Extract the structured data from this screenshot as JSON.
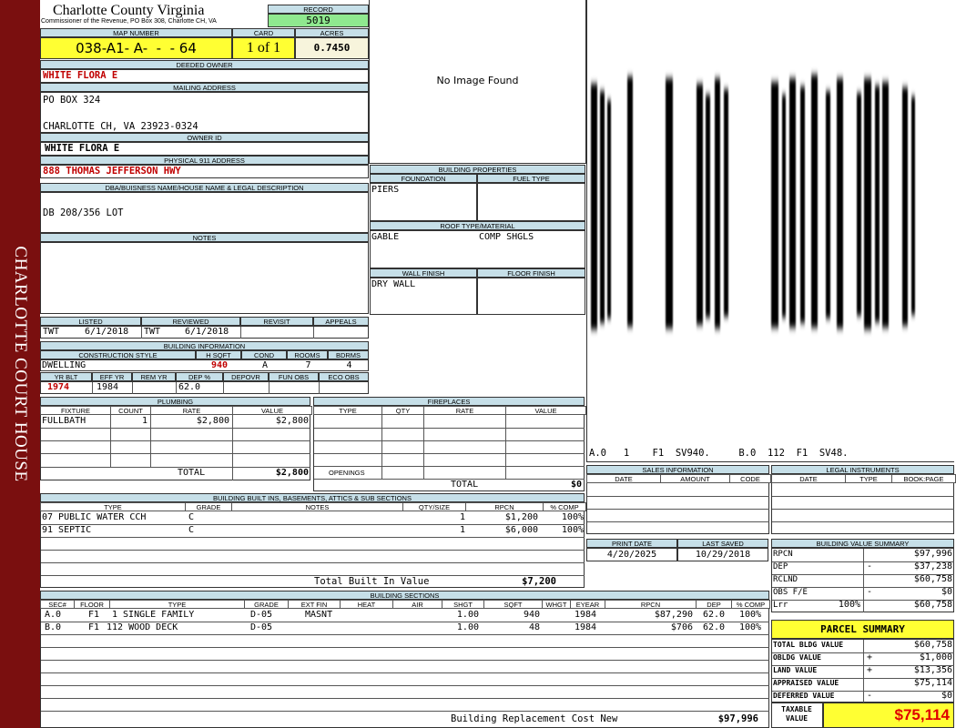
{
  "sidebar": {
    "text": "CHARLOTTE COURT HOUSE",
    "color": "#7a0f0f"
  },
  "header": {
    "county": "Charlotte County Virginia",
    "subtitle": "Commissioner of the Revenue, PO Box 308, Charlotte CH, VA",
    "record_label": "RECORD",
    "record": "5019",
    "map_number_label": "MAP NUMBER",
    "map_number": "038-A1- A-  -  - 64",
    "card_label": "CARD",
    "card": "1 of 1",
    "acres_label": "ACRES",
    "acres": "0.7450"
  },
  "owner": {
    "deeded_label": "DEEDED OWNER",
    "deeded": "WHITE FLORA E",
    "mailing_label": "MAILING ADDRESS",
    "mailing_line1": "PO BOX 324",
    "mailing_line2": "CHARLOTTE CH, VA 23923-0324",
    "owner_id_label": "OWNER ID",
    "owner_id": "WHITE FLORA E",
    "physical_label": "PHYSICAL 911 ADDRESS",
    "physical": "888 THOMAS JEFFERSON HWY",
    "dba_label": "DBA/BUISNESS NAME/HOUSE NAME & LEGAL DESCRIPTION",
    "dba": "DB 208/356 LOT",
    "notes_label": "NOTES"
  },
  "image": {
    "text": "No Image Found"
  },
  "building_properties": {
    "title": "BUILDING PROPERTIES",
    "foundation_label": "FOUNDATION",
    "foundation": "PIERS",
    "fuel_label": "FUEL TYPE",
    "roof_label": "ROOF TYPE/MATERIAL",
    "roof_type": "GABLE",
    "roof_material": "COMP SHGLS",
    "wall_label": "WALL FINISH",
    "wall": "DRY WALL",
    "floor_label": "FLOOR FINISH"
  },
  "sketch": {
    "caption": "A.0   1    F1  SV940.     B.0  112  F1  SV48."
  },
  "review": {
    "listed_label": "LISTED",
    "listed_by": "TWT",
    "listed_date": "6/1/2018",
    "reviewed_label": "REVIEWED",
    "reviewed_by": "TWT",
    "reviewed_date": "6/1/2018",
    "revisit_label": "REVISIT",
    "appeals_label": "APPEALS"
  },
  "building_info": {
    "title": "BUILDING INFORMATION",
    "style_label": "CONSTRUCTION STYLE",
    "style": "DWELLING",
    "hsqft_label": "H SQFT",
    "hsqft": "940",
    "cond_label": "COND",
    "cond": "A",
    "rooms_label": "ROOMS",
    "rooms": "7",
    "bdrms_label": "BDRMS",
    "bdrms": "4",
    "yrblt_label": "YR BLT",
    "yrblt": "1974",
    "effyr_label": "EFF YR",
    "effyr": "1984",
    "remyr_label": "REM YR",
    "dep_label": "DEP %",
    "dep": "62.0",
    "depovr_label": "DEPOVR",
    "funobs_label": "FUN OBS",
    "ecoobs_label": "ECO OBS"
  },
  "plumbing": {
    "title": "PLUMBING",
    "headers": [
      "FIXTURE",
      "COUNT",
      "RATE",
      "VALUE"
    ],
    "rows": [
      {
        "fixture": "FULLBATH",
        "count": "1",
        "rate": "$2,800",
        "value": "$2,800"
      }
    ],
    "total_label": "TOTAL",
    "total": "$2,800"
  },
  "fireplaces": {
    "title": "FIREPLACES",
    "headers": [
      "TYPE",
      "QTY",
      "RATE",
      "VALUE"
    ],
    "openings_label": "OPENINGS",
    "total_label": "TOTAL",
    "total": "$0"
  },
  "built_ins": {
    "title": "BUILDING BUILT INS, BASEMENTS, ATTICS & SUB SECTIONS",
    "headers": [
      "TYPE",
      "GRADE",
      "NOTES",
      "QTY/SIZE",
      "RPCN",
      "% COMP"
    ],
    "rows": [
      {
        "type": "07 PUBLIC WATER CCH",
        "grade": "C",
        "notes": "",
        "qty": "1",
        "rpcn": "$1,200",
        "comp": "100%"
      },
      {
        "type": "91 SEPTIC",
        "grade": "C",
        "notes": "",
        "qty": "1",
        "rpcn": "$6,000",
        "comp": "100%"
      }
    ],
    "total_label": "Total Built In Value",
    "total": "$7,200"
  },
  "sales": {
    "title": "SALES INFORMATION",
    "headers": [
      "DATE",
      "AMOUNT",
      "CODE"
    ]
  },
  "legal": {
    "title": "LEGAL INSTRUMENTS",
    "headers": [
      "DATE",
      "TYPE",
      "BOOK:PAGE"
    ]
  },
  "dates": {
    "print_label": "PRINT DATE",
    "print": "4/20/2025",
    "saved_label": "LAST SAVED",
    "saved": "10/29/2018"
  },
  "value_summary": {
    "title": "BUILDING VALUE SUMMARY",
    "rows": [
      {
        "label": "RPCN",
        "sign": "",
        "value": "$97,996"
      },
      {
        "label": "DEP",
        "sign": "-",
        "value": "$37,238"
      },
      {
        "label": "RCLND",
        "sign": "",
        "value": "$60,758"
      },
      {
        "label": "OBS F/E",
        "sign": "-",
        "value": "$0"
      },
      {
        "label": "Lrr",
        "sign": "100%",
        "value": "$60,758"
      }
    ]
  },
  "sections": {
    "title": "BUILDING SECTIONS",
    "headers": [
      "SEC#",
      "FLOOR",
      "TYPE",
      "GRADE",
      "EXT FIN",
      "HEAT",
      "AIR",
      "SHGT",
      "SQFT",
      "WHGT",
      "EYEAR",
      "RPCN",
      "DEP",
      "% COMP"
    ],
    "rows": [
      {
        "sec": "A.0",
        "floor": "F1",
        "type": "1 SINGLE FAMILY",
        "grade": "D-05",
        "ext": "MASNT",
        "heat": "",
        "air": "",
        "shgt": "1.00",
        "sqft": "940",
        "whgt": "",
        "eyear": "1984",
        "rpcn": "$87,290",
        "dep": "62.0",
        "comp": "100%"
      },
      {
        "sec": "B.0",
        "floor": "F1",
        "type": "112 WOOD DECK",
        "grade": "D-05",
        "ext": "",
        "heat": "",
        "air": "",
        "shgt": "1.00",
        "sqft": "48",
        "whgt": "",
        "eyear": "1984",
        "rpcn": "$706",
        "dep": "62.0",
        "comp": "100%"
      }
    ],
    "replacement_label": "Building Replacement Cost New",
    "replacement": "$97,996"
  },
  "parcel": {
    "title": "PARCEL SUMMARY",
    "rows": [
      {
        "label": "TOTAL BLDG VALUE",
        "sign": "",
        "value": "$60,758"
      },
      {
        "label": "OBLDG VALUE",
        "sign": "+",
        "value": "$1,000"
      },
      {
        "label": "LAND VALUE",
        "sign": "+",
        "value": "$13,356"
      },
      {
        "label": "APPRAISED VALUE",
        "sign": "",
        "value": "$75,114"
      },
      {
        "label": "DEFERRED VALUE",
        "sign": "-",
        "value": "$0"
      }
    ],
    "taxable_label": "TAXABLE VALUE",
    "taxable": "$75,114"
  }
}
